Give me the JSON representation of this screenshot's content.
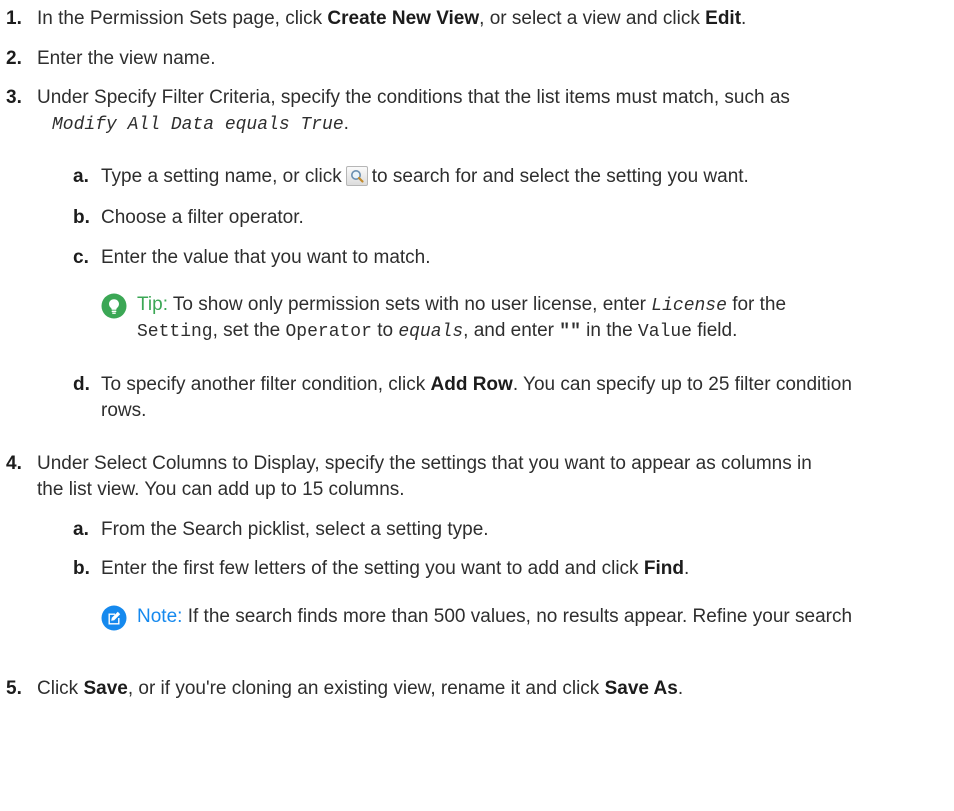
{
  "steps": [
    {
      "num": "1.",
      "pre": "In the Permission Sets page, click ",
      "b1": "Create New View",
      "mid": ", or select a view and click ",
      "b2": "Edit",
      "post": "."
    },
    {
      "num": "2.",
      "text": "Enter the view name."
    },
    {
      "num": "3.",
      "line1": "Under Specify Filter Criteria, specify the conditions that the list items must match, such as",
      "code": "Modify All Data equals True",
      "post": "."
    },
    {
      "num": "4.",
      "line1": "Under Select Columns to Display, specify the settings that you want to appear as columns in",
      "line2": "the list view. You can add up to 15 columns."
    },
    {
      "num": "5.",
      "pre": "Click ",
      "b1": "Save",
      "mid": ", or if you're cloning an existing view, rename it and click ",
      "b2": "Save As",
      "post": "."
    }
  ],
  "substeps3": [
    {
      "num": "a.",
      "pre": "Type a setting name, or click",
      "post": "to search for and select the setting you want."
    },
    {
      "num": "b.",
      "text": "Choose a filter operator."
    },
    {
      "num": "c.",
      "text": "Enter the value that you want to match."
    },
    {
      "num": "d.",
      "pre": "To specify another filter condition, click ",
      "b": "Add Row",
      "post": ". You can specify up to 25 filter condition",
      "line2": "rows."
    }
  ],
  "tip": {
    "label": "Tip:",
    "t1": " To show only permission sets with no user license, enter ",
    "c1": "License",
    "t2": " for the",
    "c2": "Setting",
    "t3": ", set the ",
    "c3": "Operator",
    "t4": " to ",
    "c4": "equals",
    "t5": ", and enter ",
    "c5": "\"\"",
    "t6": " in the ",
    "c6": "Value",
    "t7": " field."
  },
  "substeps4": [
    {
      "num": "a.",
      "text": "From the Search picklist, select a setting type."
    },
    {
      "num": "b.",
      "pre": "Enter the first few letters of the setting you want to add and click ",
      "b": "Find",
      "post": "."
    }
  ],
  "note": {
    "label": "Note:",
    "text": " If the search finds more than 500 values, no results appear. Refine your search"
  },
  "colors": {
    "tip": "#3ba755",
    "note": "#1589ee"
  },
  "icons": {
    "tip": "lightbulb-icon",
    "note": "edit-note-icon",
    "search": "magnifier-icon"
  }
}
